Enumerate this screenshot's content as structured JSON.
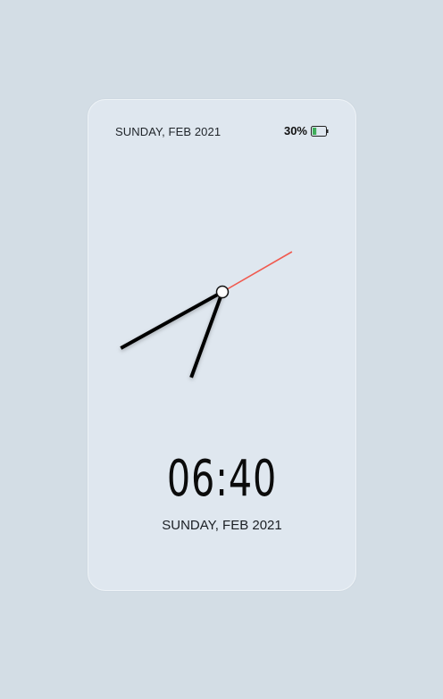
{
  "status_bar": {
    "date": "SUNDAY, FEB 2021",
    "battery_percent": "30%",
    "battery_level": 0.3,
    "battery_icon": "battery-icon",
    "battery_fill_color": "#3fae5a"
  },
  "analog_clock": {
    "hours": 6,
    "minutes": 40,
    "seconds": 10,
    "second_hand_color": "#f05a4f",
    "hand_color": "#000000"
  },
  "digital_clock": {
    "time": "06:40",
    "date": "SUNDAY, FEB 2021"
  }
}
